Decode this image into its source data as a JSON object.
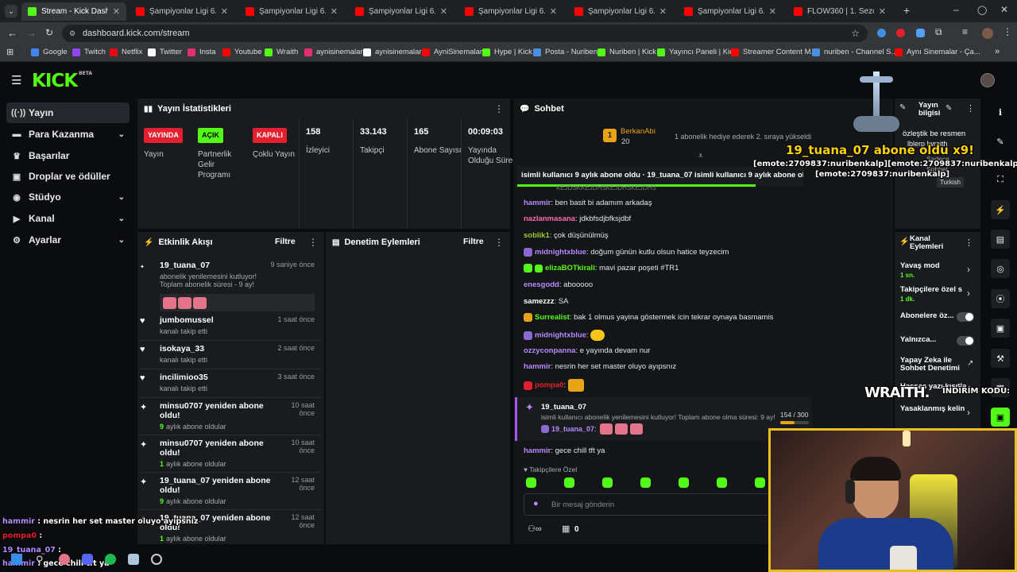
{
  "tabs": [
    {
      "label": "Stream - Kick Dashboard",
      "active": true,
      "color": "#53fc18"
    },
    {
      "label": "Şampiyonlar Ligi 6. Hafta",
      "color": "#ff0000"
    },
    {
      "label": "Şampiyonlar Ligi 6. Hafta",
      "color": "#ff0000"
    },
    {
      "label": "Şampiyonlar Ligi 6. Hafta",
      "color": "#ff0000"
    },
    {
      "label": "Şampiyonlar Ligi 6. Hafta",
      "color": "#ff0000"
    },
    {
      "label": "Şampiyonlar Ligi 6. Hafta",
      "color": "#ff0000"
    },
    {
      "label": "Şampiyonlar Ligi 6. Hafta",
      "color": "#ff0000"
    },
    {
      "label": "FLOW360 | 1. Sezon 5. Bö",
      "color": "#ff0000"
    }
  ],
  "address": {
    "url": "dashboard.kick.com/stream"
  },
  "bookmarks": [
    {
      "label": "Google",
      "color": "#4285f4"
    },
    {
      "label": "Twitch",
      "color": "#9146ff"
    },
    {
      "label": "Netflix",
      "color": "#e50914"
    },
    {
      "label": "Twitter",
      "color": "#ffffff"
    },
    {
      "label": "Insta",
      "color": "#e1306c"
    },
    {
      "label": "Youtube",
      "color": "#ff0000"
    },
    {
      "label": "Wraith",
      "color": "#53fc18"
    },
    {
      "label": "aynisinemalar",
      "color": "#e1306c"
    },
    {
      "label": "aynisinemalar",
      "color": "#ffffff"
    },
    {
      "label": "AyniSinemalar",
      "color": "#ff0000"
    },
    {
      "label": "Hype | Kick",
      "color": "#53fc18"
    },
    {
      "label": "Posta - Nuriben",
      "color": "#4a90e2"
    },
    {
      "label": "Nuriben | Kick",
      "color": "#53fc18"
    },
    {
      "label": "Yayıncı Paneli | Kick",
      "color": "#53fc18"
    },
    {
      "label": "Streamer Content M...",
      "color": "#ff0000"
    },
    {
      "label": "nuriben - Channel S...",
      "color": "#4a90e2"
    },
    {
      "label": "Aynı Sinemalar - Ça...",
      "color": "#ff0000"
    }
  ],
  "kick": {
    "logo": "KICK",
    "beta": "BETA"
  },
  "sidebar": {
    "items": [
      {
        "label": "Yayın",
        "icon": "broadcast-icon",
        "glyph": "((·))",
        "active": true
      },
      {
        "label": "Para Kazanma",
        "icon": "money-icon",
        "glyph": "▬",
        "chev": "⌄"
      },
      {
        "label": "Başarılar",
        "icon": "trophy-icon",
        "glyph": "♛"
      },
      {
        "label": "Droplar ve ödüller",
        "icon": "gift-icon",
        "glyph": "▣"
      },
      {
        "label": "Stüdyo",
        "icon": "studio-icon",
        "glyph": "◉",
        "chev": "⌄"
      },
      {
        "label": "Kanal",
        "icon": "channel-icon",
        "glyph": "▶",
        "chev": "⌄"
      },
      {
        "label": "Ayarlar",
        "icon": "settings-icon",
        "glyph": "⚙",
        "chev": "⌄"
      }
    ]
  },
  "stats": {
    "title": "Yayın İstatistikleri",
    "items": [
      {
        "badge": "YAYINDA",
        "badge_color": "#e5202e",
        "label": "Yayın"
      },
      {
        "badge": "AÇIK",
        "badge_color": "#53fc18",
        "label": "Partnerlik Gelir Programı"
      },
      {
        "badge": "KAPALI",
        "badge_color": "#e5202e",
        "label": "Çoklu Yayın"
      },
      {
        "value": "158",
        "label": "İzleyici"
      },
      {
        "value": "33.143",
        "label": "Takipçi"
      },
      {
        "value": "165",
        "label": "Abone Sayısı"
      },
      {
        "value": "00:09:03",
        "label": "Yayında Olduğu Süre"
      }
    ]
  },
  "activity": {
    "title": "Etkinlik Akışı",
    "filter": "Filtre",
    "items": [
      {
        "user": "19_tuana_07",
        "time": "9 saniye önce",
        "sub": "abonelik yenilemesini kutluyor! Toplam abonelik süresi - 9 ay!",
        "icon": "sub-icon"
      },
      {
        "user": "jumbomussel",
        "time": "1 saat önce",
        "sub": "kanalı takip etti",
        "icon": "heart-icon"
      },
      {
        "user": "isokaya_33",
        "time": "2 saat önce",
        "sub": "kanalı takip etti",
        "icon": "heart-icon"
      },
      {
        "user": "incilimioo35",
        "time": "3 saat önce",
        "sub": "kanalı takip etti",
        "icon": "heart-icon"
      },
      {
        "user": "minsu0707 yeniden abone oldu!",
        "time": "10 saat önce",
        "months": "9",
        "sub": "aylık abone oldular",
        "icon": "sparkle-icon"
      },
      {
        "user": "minsu0707 yeniden abone oldu!",
        "time": "10 saat önce",
        "months": "1",
        "sub": "aylık abone oldular",
        "icon": "sparkle-icon"
      },
      {
        "user": "19_tuana_07 yeniden abone oldu!",
        "time": "12 saat önce",
        "months": "9",
        "sub": "aylık abone oldular",
        "icon": "sparkle-icon"
      },
      {
        "user": "19_tuana_07 yeniden abone oldu!",
        "time": "12 saat önce",
        "months": "1",
        "sub": "aylık abone oldular",
        "icon": "sparkle-icon"
      }
    ]
  },
  "moderation": {
    "title": "Denetim Eylemleri",
    "filter": "Filtre"
  },
  "chat": {
    "title": "Sohbet",
    "pinned_user": "BerkanAbi",
    "pinned_count": "20",
    "pinned_rank": "1",
    "pinned_text": "1 abonelik hediye ederek 2. sıraya yükseldi",
    "ticker": "isimli kullanıcı 9 aylık abone oldu ·  19_tuana_07 isimli kullanıcı 9 aylık abone oldu",
    "cut_line": "KEJDSKKEJDHSKEJDHSKEJDHS",
    "messages": [
      {
        "user": "hammir",
        "color": "#b48cff",
        "text": "ben basit bi adamım arkadaş"
      },
      {
        "user": "nazlanmasana",
        "color": "#ff69b4",
        "text": "jdkbfsdjbfksjdbf"
      },
      {
        "user": "soblik1",
        "color": "#9acd32",
        "text": "çok düşünülmüş"
      },
      {
        "user": "midnightxblue",
        "color": "#b48cff",
        "text": "doğum günün kutlu olsun hatice teyzecim"
      },
      {
        "user": "elizaBOTkirali",
        "color": "#53fc18",
        "text": "mavi pazar poşeti #TR1"
      },
      {
        "user": "enesgodd",
        "color": "#b48cff",
        "text": "abooooo"
      },
      {
        "user": "samezzz",
        "color": "#ffffff",
        "text": "SA"
      },
      {
        "user": "Surrealist",
        "color": "#53fc18",
        "text": "bak 1 olmus yayina göstermek icin tekrar oynaya basmamis"
      },
      {
        "user": "midnightxblue",
        "color": "#b48cff",
        "text": ""
      },
      {
        "user": "ozzyconpanna",
        "color": "#b48cff",
        "text": "e yayında devam nur"
      },
      {
        "user": "hammir",
        "color": "#b48cff",
        "text": "nesrin her set master oluyo ayıpsnız"
      },
      {
        "user": "pompa0",
        "color": "#e5202e",
        "text": ""
      }
    ],
    "sub_user": "19_tuana_07",
    "sub_text": "isimli kullanıcı abonelik yenilemesini kutluyor! Toplam abone olma süresi: 9 ay!",
    "sub_progress": "154 / 300",
    "sub_progress_fraction": 0.51,
    "sub_line_user": "19_tuana_07",
    "last_user": "hammir",
    "last_text": "gece chill tft ya",
    "followers_only": "Takipçilere Özel",
    "input_placeholder": "Bir mesaj gönderin",
    "points": "0"
  },
  "streaminfo": {
    "title": "Yayın bilgisi",
    "lines": [
      "özleştik be resmen",
      "lblerp lwraith",
      "Sadece",
      "Sohbet",
      "Turkish"
    ]
  },
  "channel_actions": {
    "title": "Kanal Eylemleri",
    "items": [
      {
        "label": "Yavaş mod",
        "sub": "1 sn."
      },
      {
        "label": "Takipçilere özel s",
        "sub": "1 dk."
      },
      {
        "label": "Abonelere öz..."
      },
      {
        "label": "Yalnızca..."
      },
      {
        "label": "Yapay Zeka ile Sohbet Denetimi"
      },
      {
        "label": "Hassas yazı kısıtla"
      },
      {
        "label": "Yasaklanmış kelin"
      }
    ]
  },
  "overlay": {
    "alert": "19_tuana_07 abone oldu x9!",
    "emote_line": "[emote:2709837:nuribenkalp][emote:2709837:nuribenkalp]",
    "emote_line2": "[emote:2709837:nuribenkalp]",
    "wraith": "WRAITH.",
    "wraith_sub": "İNDİRİM KODU:",
    "overlay_chat": [
      {
        "user": "hammir",
        "color": "#b48cff",
        "text": "nesrin her set master oluyo ayıpsnız"
      },
      {
        "user": "pompa0",
        "color": "#e5202e",
        "text": ""
      },
      {
        "user": "19_tuana_07",
        "color": "#b48cff",
        "text": ""
      },
      {
        "user": "hammir",
        "color": "#b48cff",
        "text": "gece chill tft ya"
      }
    ]
  }
}
